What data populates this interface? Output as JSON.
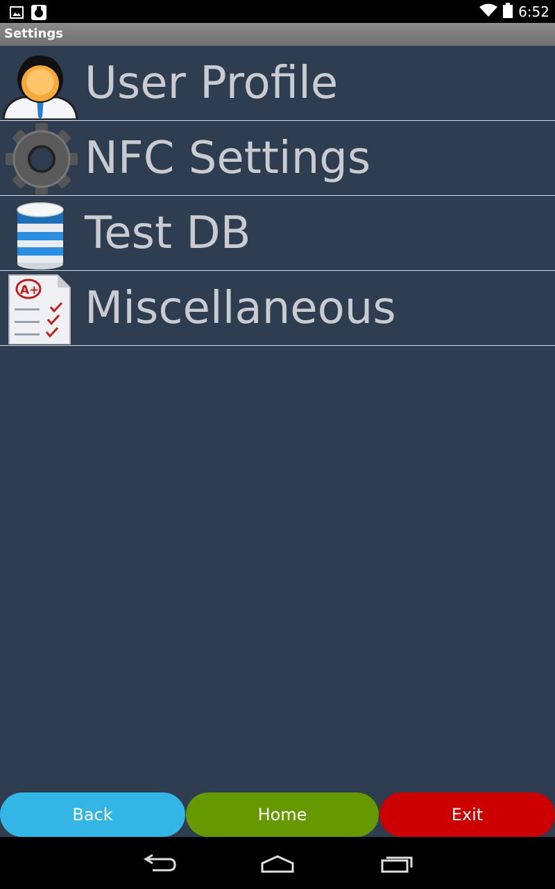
{
  "status_bar": {
    "time": "6:52",
    "left_icons": [
      "gallery-notification-icon",
      "app-notification-icon"
    ],
    "right_icons": [
      "wifi-icon",
      "battery-icon"
    ]
  },
  "title_bar": {
    "title": "Settings"
  },
  "menu": {
    "items": [
      {
        "label": "User Profile",
        "icon": "user-profile-icon"
      },
      {
        "label": "NFC Settings",
        "icon": "gear-icon"
      },
      {
        "label": "Test DB",
        "icon": "database-icon"
      },
      {
        "label": "Miscellaneous",
        "icon": "checklist-document-icon"
      }
    ]
  },
  "buttons": {
    "back": {
      "label": "Back",
      "color": "#33b5e5"
    },
    "home": {
      "label": "Home",
      "color": "#669900"
    },
    "exit": {
      "label": "Exit",
      "color": "#cc0000"
    }
  },
  "nav_bar": {
    "icons": [
      "nav-back-icon",
      "nav-home-icon",
      "nav-recent-apps-icon"
    ]
  },
  "colors": {
    "background": "#2f3d50",
    "label_text": "#c8cbd0",
    "divider": "#d9dde2"
  }
}
